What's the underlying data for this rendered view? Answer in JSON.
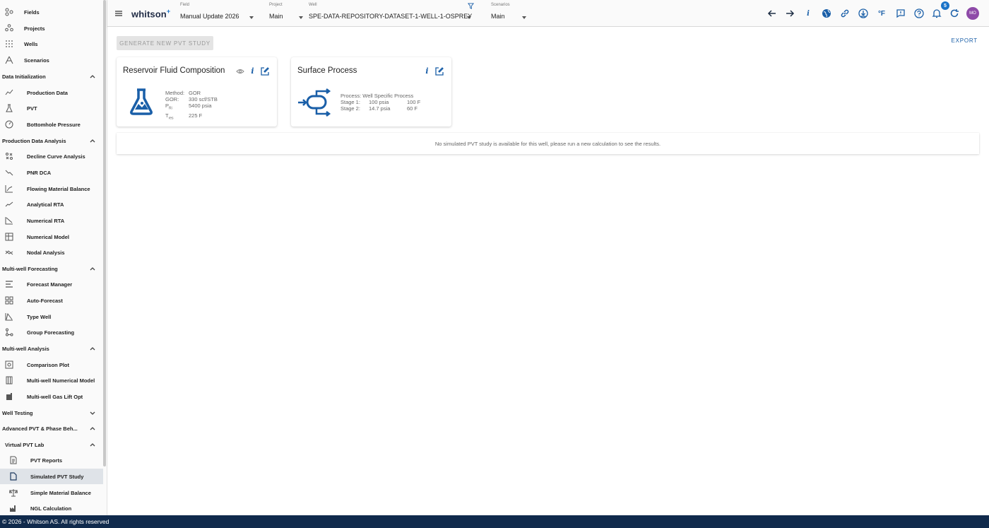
{
  "sidebar": {
    "top_items": [
      {
        "label": "Fields",
        "icon": "fields-icon"
      },
      {
        "label": "Projects",
        "icon": "projects-icon"
      },
      {
        "label": "Wells",
        "icon": "wells-icon"
      },
      {
        "label": "Scenarios",
        "icon": "scenarios-icon"
      }
    ],
    "sections": {
      "data_init": {
        "label": "Data Initialization",
        "items": [
          {
            "label": "Production Data",
            "icon": "production-data-icon"
          },
          {
            "label": "PVT",
            "icon": "pvt-flask-icon"
          },
          {
            "label": "Bottomhole Pressure",
            "icon": "gauge-icon"
          }
        ]
      },
      "pda": {
        "label": "Production Data Analysis",
        "items": [
          {
            "label": "Decline Curve Analysis",
            "icon": "dca-icon"
          },
          {
            "label": "PNR DCA",
            "icon": "pnr-dca-icon"
          },
          {
            "label": "Flowing Material Balance",
            "icon": "fmb-chart-icon"
          },
          {
            "label": "Analytical RTA",
            "icon": "rta-icon"
          },
          {
            "label": "Numerical RTA",
            "icon": "numerical-rta-icon"
          },
          {
            "label": "Numerical Model",
            "icon": "numerical-model-icon"
          },
          {
            "label": "Nodal Analysis",
            "icon": "nodal-icon"
          }
        ]
      },
      "mwf": {
        "label": "Multi-well Forecasting",
        "items": [
          {
            "label": "Forecast Manager",
            "icon": "list-icon"
          },
          {
            "label": "Auto-Forecast",
            "icon": "grid-icon"
          },
          {
            "label": "Type Well",
            "icon": "type-well-icon"
          },
          {
            "label": "Group Forecasting",
            "icon": "group-icon"
          }
        ]
      },
      "mwa": {
        "label": "Multi-well Analysis",
        "items": [
          {
            "label": "Comparison Plot",
            "icon": "comparison-icon"
          },
          {
            "label": "Multi-well Numerical Model",
            "icon": "columns-icon"
          },
          {
            "label": "Multi-well Gas Lift Opt",
            "icon": "gas-lift-icon"
          }
        ]
      },
      "well_testing": {
        "label": "Well Testing"
      },
      "adv_pvt": {
        "label": "Advanced PVT & Phase Beh..."
      },
      "vpl": {
        "label": "Virtual PVT Lab",
        "items": [
          {
            "label": "PVT Reports",
            "icon": "report-icon"
          },
          {
            "label": "Simulated PVT Study",
            "icon": "document-icon"
          },
          {
            "label": "Simple Material Balance",
            "icon": "scale-icon"
          },
          {
            "label": "NGL Calculation",
            "icon": "factory-icon"
          }
        ]
      }
    }
  },
  "topbar": {
    "logo": "whitson",
    "logo_plus": "+",
    "field": {
      "caption": "Field",
      "value": "Manual Update 2026"
    },
    "project": {
      "caption": "Project",
      "value": "Main"
    },
    "well": {
      "caption": "Well",
      "value": "SPE-DATA-REPOSITORY-DATASET-1-WELL-1-OSPREY"
    },
    "scenarios": {
      "caption": "Scenarios",
      "value": "Main"
    },
    "units_label": "°F",
    "info_label": "i",
    "notifications_count": "5",
    "avatar_initials": "MO"
  },
  "main": {
    "generate_button": "GENERATE NEW PVT STUDY",
    "export_button": "EXPORT",
    "reservoir_card": {
      "title": "Reservoir Fluid Composition",
      "rows": [
        {
          "k": "Method:",
          "v": "GOR"
        },
        {
          "k": "GOR:",
          "v": "330 scf/STB"
        },
        {
          "k": "P",
          "sub": "Ri",
          "v": "5400 psia"
        },
        {
          "k": "T",
          "sub": "res",
          "v": "225 F"
        }
      ]
    },
    "surface_card": {
      "title": "Surface Process",
      "process": "Process: Well Specific Process",
      "stages": [
        {
          "k": "Stage 1:",
          "p": "100 psia",
          "t": "100 F"
        },
        {
          "k": "Stage 2:",
          "p": "14.7 psia",
          "t": "60 F"
        }
      ]
    },
    "notice": "No simulated PVT study is available for this well, please run a new calculation to see the results."
  },
  "footer": {
    "text": "© 2026 - Whitson AS. All rights reserved"
  },
  "colors": {
    "accent": "#1a5fa8",
    "footer_bg": "#102a4c",
    "active_bg": "#dfe3e8",
    "avatar": "#8e4aa8"
  }
}
